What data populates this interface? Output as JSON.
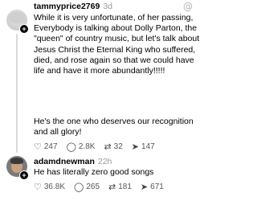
{
  "threads_icon": "threads-logo-icon",
  "post1": {
    "username": "tammyprice2769",
    "time": "3d",
    "text_part1": "While it is very unfortunate, of her passing, Everybody is talking about Dolly Parton, the \"queen\" of country music, but let's talk about Jesus Christ the Eternal King who suffered, died, and rose again so that we could have life and have it more abundantly!!!!!",
    "text_part2": "He's the one who deserves our recognition and all glory!",
    "likes": "247",
    "comments": "2.8K",
    "reposts": "32",
    "shares": "147"
  },
  "post2": {
    "username": "adamdnewman",
    "time": "22h",
    "text": "He has literally zero good songs",
    "likes": "36.8K",
    "comments": "265",
    "reposts": "181",
    "shares": "671"
  }
}
